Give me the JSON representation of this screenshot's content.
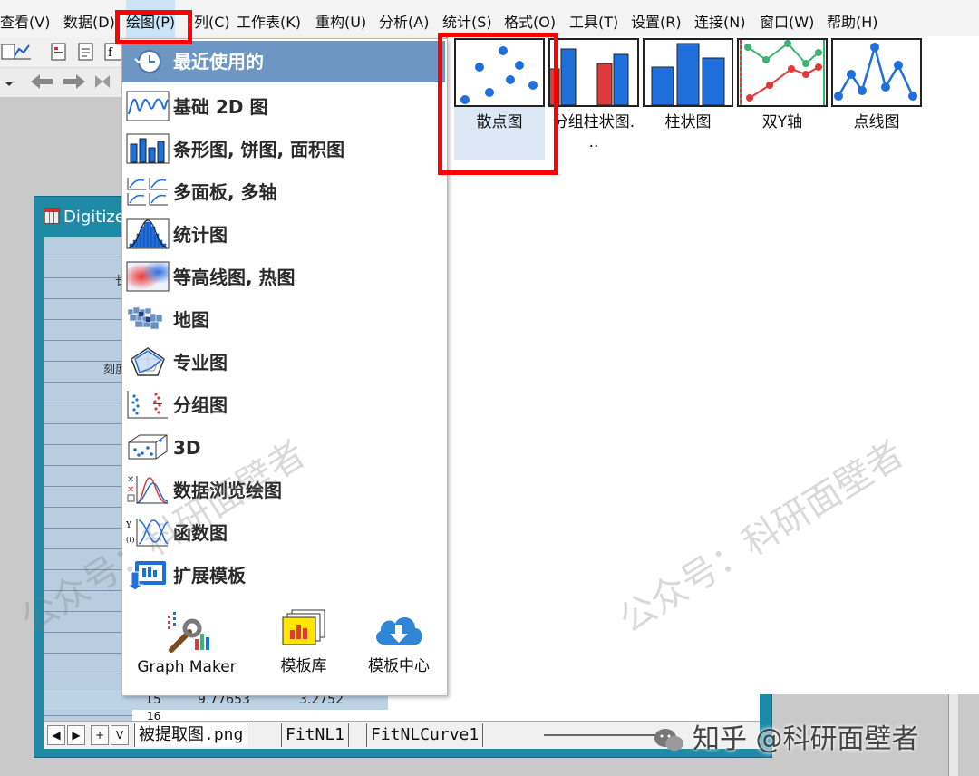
{
  "menubar": {
    "items": [
      "查看(V)",
      "数据(D)",
      "绘图(P)",
      "列(C)",
      "工作表(K)",
      "重构(U)",
      "分析(A)",
      "统计(S)",
      "格式(O)",
      "工具(T)",
      "设置(R)",
      "连接(N)",
      "窗口(W)",
      "帮助(H)"
    ],
    "active_index": 2
  },
  "worksheet": {
    "title_prefix": "Digitize",
    "row_label_1": "长",
    "row_label_2": "刻度",
    "row15": {
      "index": "15",
      "a": "9.77653",
      "b": "3.2752"
    },
    "row16_index": "16",
    "tabs": [
      "被提取图.png",
      "FitNL1",
      "FitNLCurve1"
    ],
    "nav": [
      "◀",
      "▶",
      "+",
      "V"
    ]
  },
  "graph_menu": {
    "recent": "最近使用的",
    "categories": [
      {
        "name": "basic-2d",
        "label": "基础 2D 图"
      },
      {
        "name": "bar-pie-area",
        "label": "条形图, 饼图, 面积图"
      },
      {
        "name": "multi-panel",
        "label": "多面板, 多轴"
      },
      {
        "name": "statistics",
        "label": "统计图"
      },
      {
        "name": "contour-heatmap",
        "label": "等高线图, 热图"
      },
      {
        "name": "map",
        "label": "地图"
      },
      {
        "name": "specialized",
        "label": "专业图"
      },
      {
        "name": "grouped",
        "label": "分组图"
      },
      {
        "name": "3d",
        "label": "3D"
      },
      {
        "name": "data-explore",
        "label": "数据浏览绘图"
      },
      {
        "name": "function",
        "label": "函数图"
      },
      {
        "name": "extended-templates",
        "label": "扩展模板"
      }
    ],
    "bottom_tools": {
      "graph_maker": "Graph Maker",
      "template_library": "模板库",
      "template_center": "模板中心"
    }
  },
  "gallery": {
    "items": [
      {
        "name": "scatter",
        "label": "散点图"
      },
      {
        "name": "grouped-column",
        "label": "分组柱状图...",
        "label_line1": "分组柱状图.",
        "label_line2": ".."
      },
      {
        "name": "column",
        "label": "柱状图"
      },
      {
        "name": "double-y",
        "label": "双Y轴"
      },
      {
        "name": "line-symbol",
        "label": "点线图"
      }
    ],
    "selected": "scatter"
  },
  "watermark": {
    "diagonal": "公众号：科研面壁者",
    "footer": "知乎 @科研面壁者"
  },
  "colors": {
    "accent_blue": "#6d96c4",
    "highlight_red": "#ff0000",
    "chart_blue": "#1f6fdc",
    "chart_red": "#e0393b",
    "chart_green": "#3cb371",
    "worksheet_frame": "#1e8aa5"
  }
}
